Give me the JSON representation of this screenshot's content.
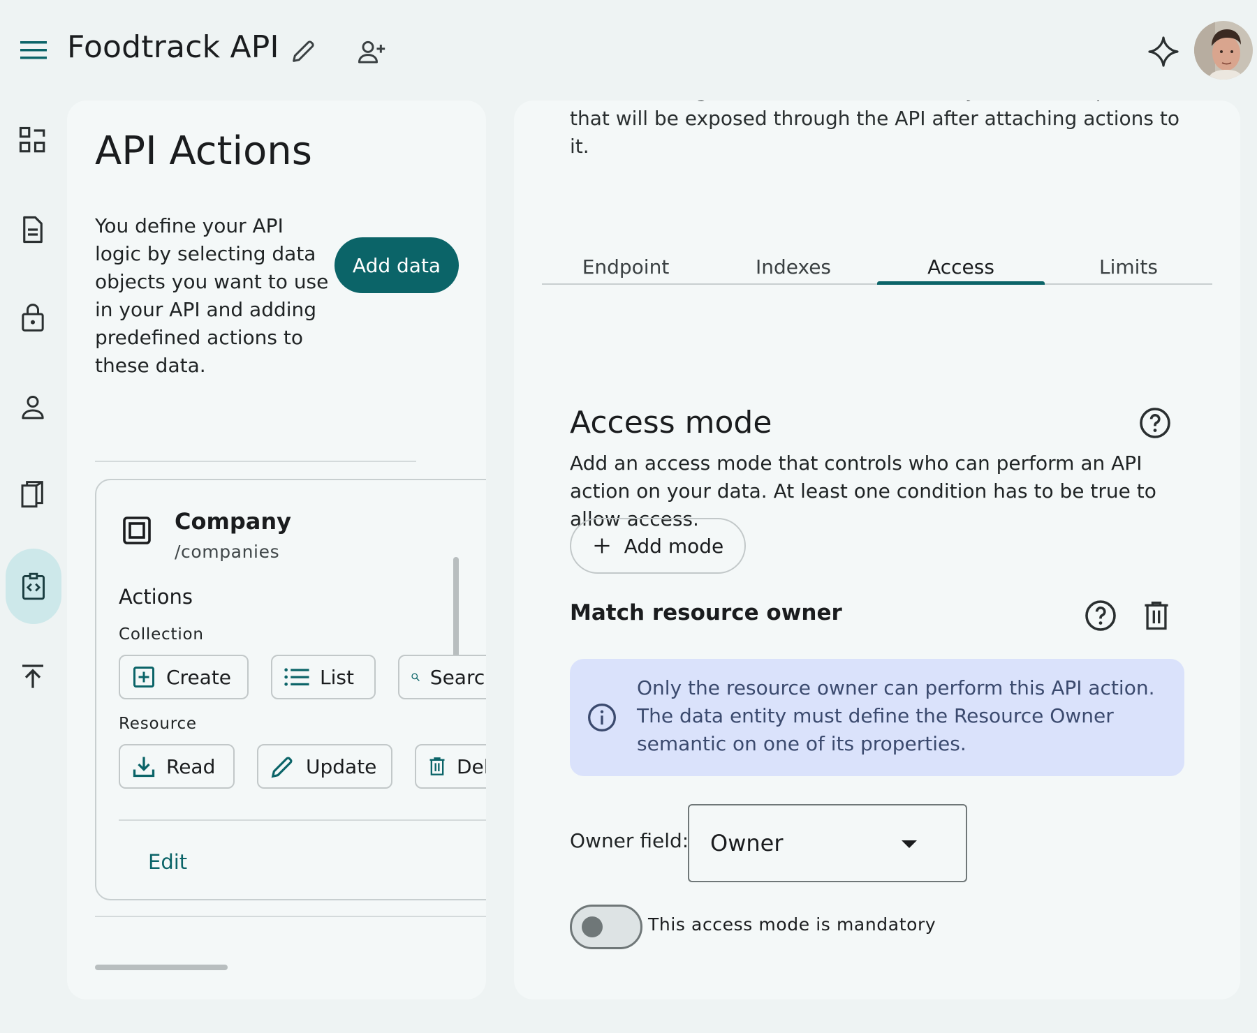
{
  "header": {
    "title": "Foodtrack API"
  },
  "left_panel": {
    "title": "API Actions",
    "description": "You define your API logic by selecting data objects you want to use in your API and adding predefined actions to these data.",
    "add_data_label": "Add data",
    "entity": {
      "name": "Company",
      "path": "/companies",
      "actions_heading": "Actions",
      "collection_heading": "Collection",
      "collection_actions": [
        "Create",
        "List",
        "Search"
      ],
      "resource_heading": "Resource",
      "resource_actions": [
        "Read",
        "Update",
        "Delete"
      ],
      "edit_label": "Edit"
    }
  },
  "right_panel": {
    "description_partial": "Define the logic related to the data entity. It is an endpoint that will be exposed through the API after attaching actions to it.",
    "tabs": [
      "Endpoint",
      "Indexes",
      "Access",
      "Limits"
    ],
    "active_tab": "Access",
    "access_mode": {
      "title": "Access mode",
      "description": "Add an access mode that controls who can perform an API action on your data. At least one condition has to be true to allow access.",
      "add_mode_label": "Add mode"
    },
    "match_owner": {
      "title": "Match resource owner",
      "info": "Only the resource owner can perform this API action. The data entity must define the Resource Owner semantic on one of its properties.",
      "owner_field_label": "Owner field:",
      "owner_field_value": "Owner",
      "mandatory_label": "This access mode is mandatory",
      "mandatory_enabled": false
    }
  },
  "colors": {
    "accent": "#0b6468",
    "background": "#eef3f3",
    "panel": "#f4f8f8",
    "info_box": "#dae2fb",
    "rail_active": "#cde8ea"
  }
}
